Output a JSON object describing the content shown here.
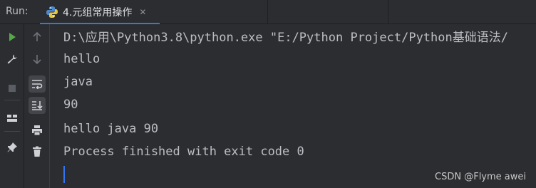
{
  "header": {
    "run_label": "Run:",
    "tab_title": "4.元组常用操作",
    "tab_close": "✕"
  },
  "toolbar": {
    "left": [
      "play-icon",
      "wrench-icon",
      "stop-icon",
      "layout-icon",
      "pin-icon"
    ],
    "right": [
      "arrow-up-icon",
      "arrow-down-icon",
      "soft-wrap-icon",
      "scroll-to-end-icon",
      "print-icon",
      "trash-icon"
    ]
  },
  "console": {
    "lines": [
      "D:\\应用\\Python3.8\\python.exe \"E:/Python Project/Python基础语法/",
      "hello",
      "java",
      "90",
      "hello java 90",
      "Process finished with exit code 0"
    ]
  },
  "watermark": "CSDN @Flyme awei",
  "colors": {
    "background": "#2b2d30",
    "text": "#bcbec4",
    "accent": "#3574f0",
    "run_green": "#57a64a"
  }
}
